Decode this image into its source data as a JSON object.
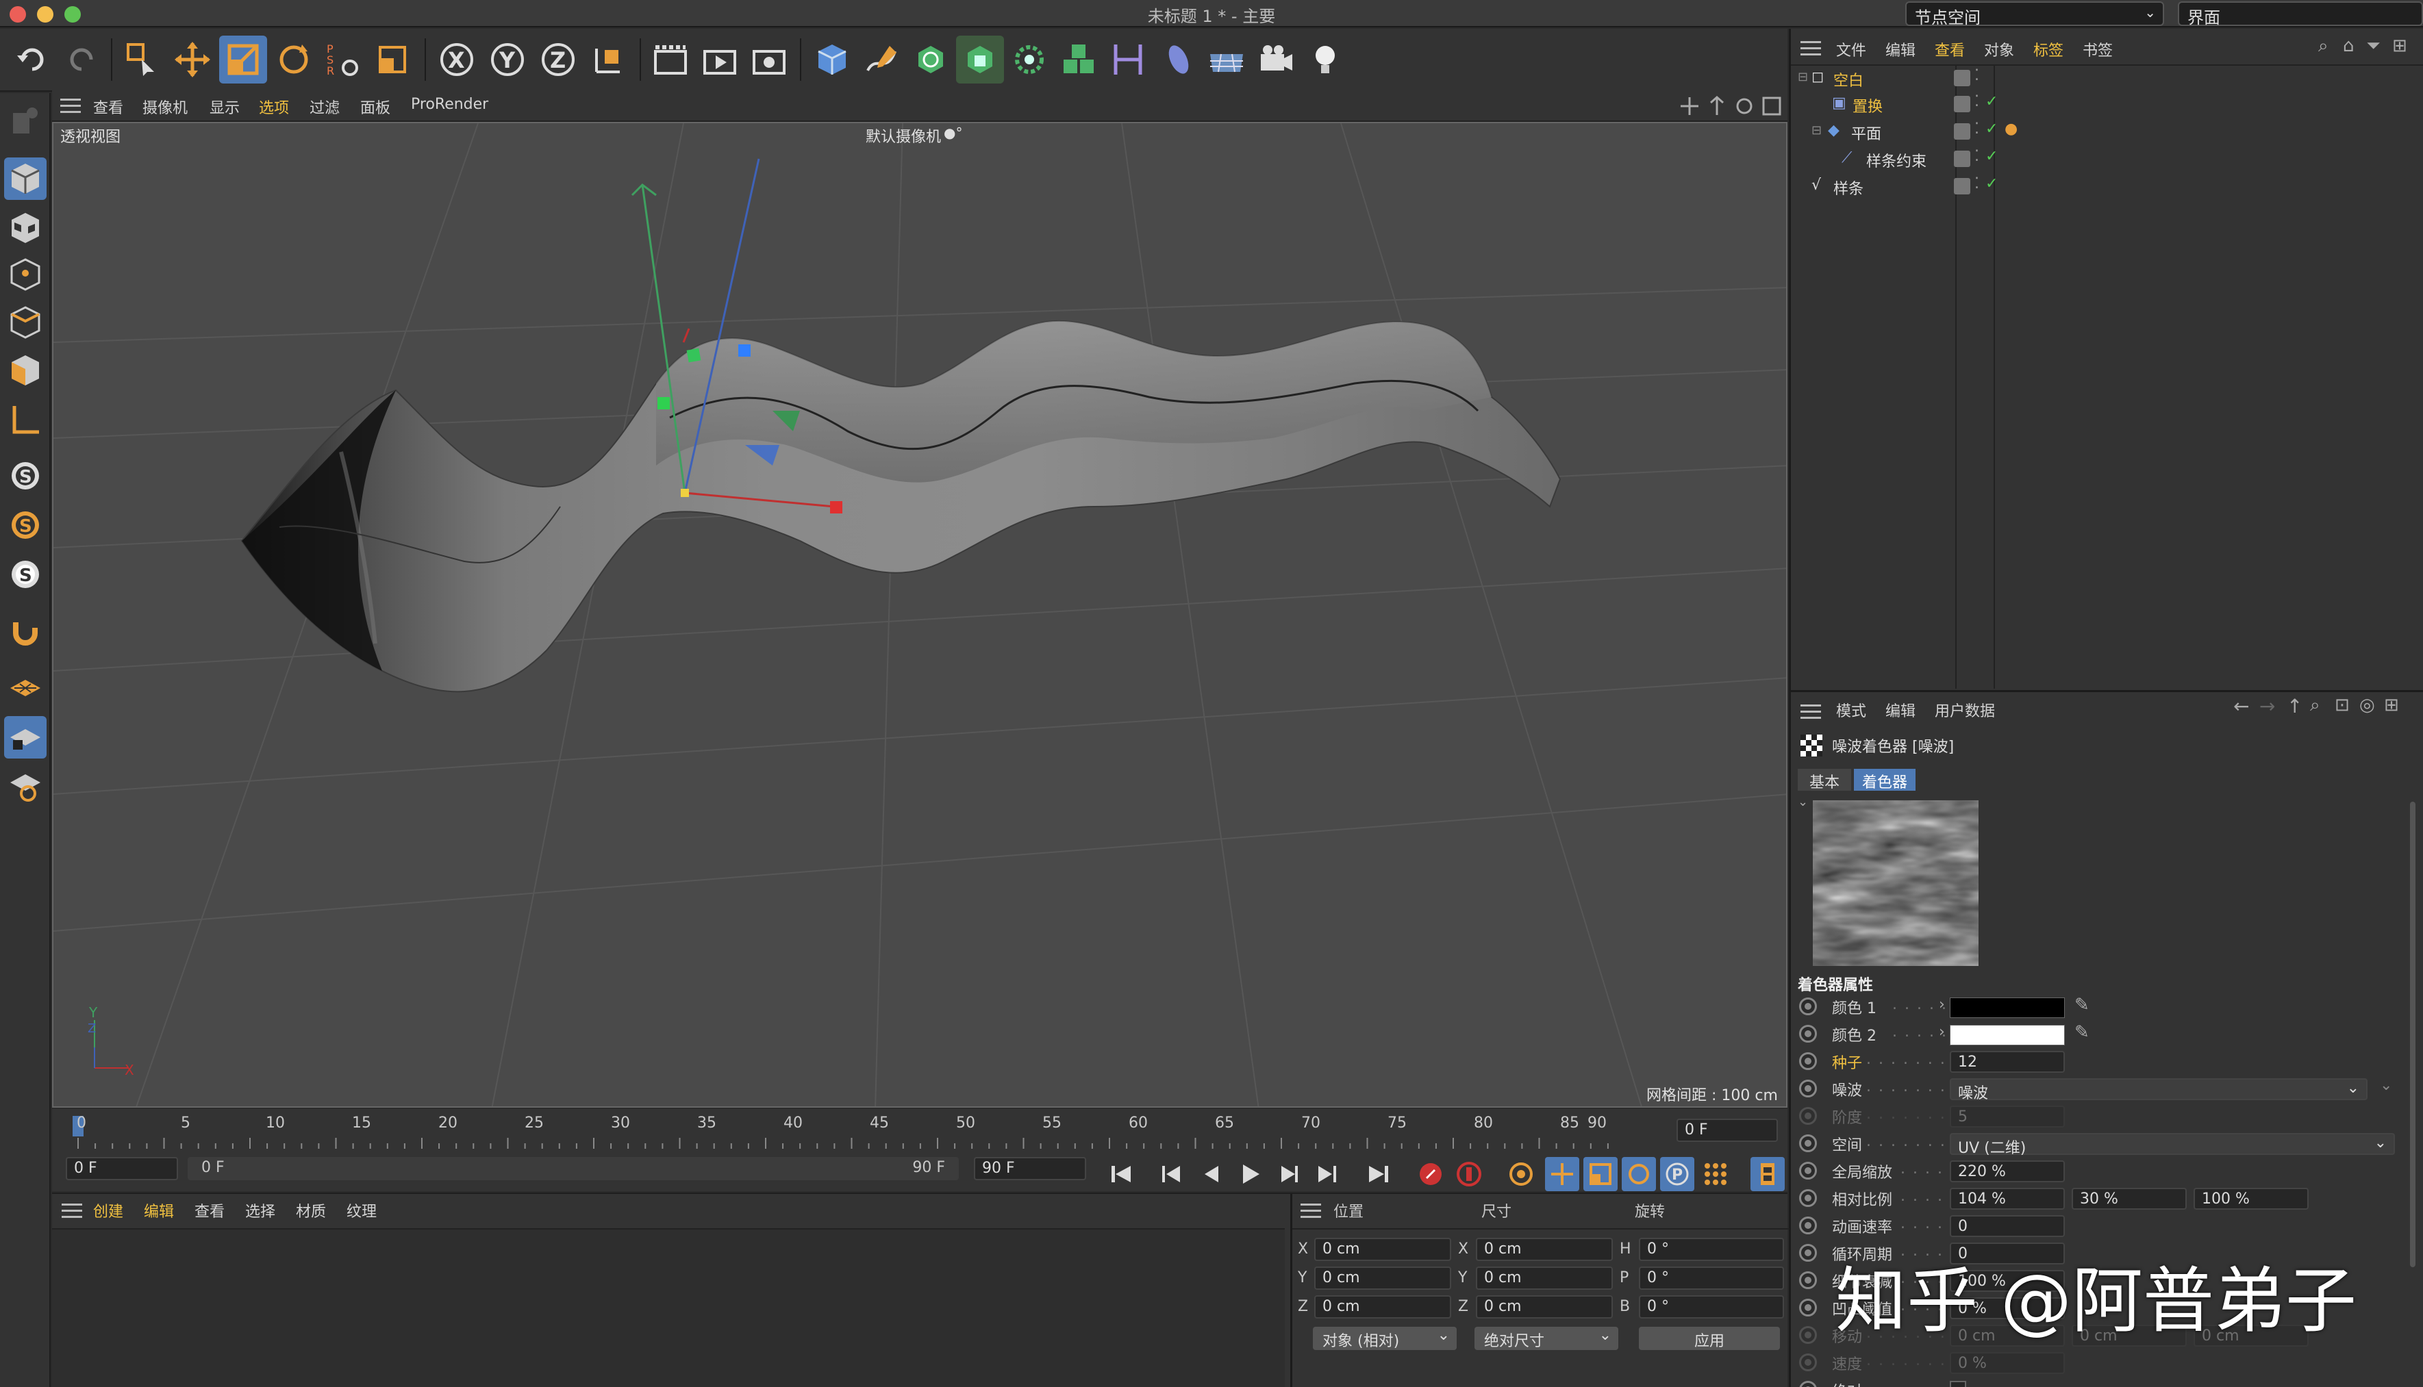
{
  "window": {
    "title": "未标题 1 * - 主要",
    "node_space": "节点空间",
    "layout": "界面"
  },
  "viewport_menu": [
    "查看",
    "摄像机",
    "显示",
    "选项",
    "过滤",
    "面板",
    "ProRender"
  ],
  "viewport": {
    "label": "透视视图",
    "camera": "默认摄像机",
    "grid_info": "网格间距 : 100 cm"
  },
  "objects_menu": [
    "文件",
    "编辑",
    "查看",
    "对象",
    "标签",
    "书签"
  ],
  "objects": [
    {
      "name": "空白",
      "icon": "null-icon"
    },
    {
      "name": "置换",
      "icon": "displacer-icon"
    },
    {
      "name": "平面",
      "icon": "plane-icon"
    },
    {
      "name": "样条约束",
      "icon": "spline-wrap-icon"
    },
    {
      "name": "样条",
      "icon": "spline-icon"
    }
  ],
  "attributes": {
    "menu": [
      "模式",
      "编辑",
      "用户数据"
    ],
    "header": "噪波着色器 [噪波]",
    "tabs": [
      "基本",
      "着色器"
    ],
    "section": "着色器属性",
    "props": [
      {
        "label": "颜色 1",
        "type": "color",
        "value": "#000000"
      },
      {
        "label": "颜色 2",
        "type": "color",
        "value": "#ffffff"
      },
      {
        "label": "种子",
        "type": "num",
        "value": "12"
      },
      {
        "label": "噪波",
        "type": "select",
        "value": "噪波"
      },
      {
        "label": "阶度",
        "type": "num",
        "value": "5"
      },
      {
        "label": "空间",
        "type": "select",
        "value": "UV (二维)"
      },
      {
        "label": "全局缩放",
        "type": "num",
        "value": "220 %"
      },
      {
        "label": "相对比例",
        "type": "vec",
        "values": [
          "104 %",
          "30 %",
          "100 %"
        ]
      },
      {
        "label": "动画速率",
        "type": "num",
        "value": "0"
      },
      {
        "label": "循环周期",
        "type": "num",
        "value": "0"
      },
      {
        "label": "细节衰减",
        "type": "num",
        "value": "100 %"
      },
      {
        "label": "凹凸阈值",
        "type": "num",
        "value": "0 %"
      },
      {
        "label": "移动",
        "type": "vec",
        "values": [
          "0 cm",
          "0 cm",
          "0 cm"
        ]
      },
      {
        "label": "速度",
        "type": "num",
        "value": "0 %"
      },
      {
        "label": "绝对",
        "type": "check",
        "value": ""
      }
    ]
  },
  "timeline": {
    "ticks": [
      "0",
      "5",
      "10",
      "15",
      "20",
      "25",
      "30",
      "35",
      "40",
      "45",
      "50",
      "55",
      "60",
      "65",
      "70",
      "75",
      "80",
      "85",
      "90"
    ],
    "current_frame": "0 F",
    "start_field": "0 F",
    "range_start": "0 F",
    "range_end": "90 F",
    "end_field": "90 F"
  },
  "materials_menu": [
    "创建",
    "编辑",
    "查看",
    "选择",
    "材质",
    "纹理"
  ],
  "coords": {
    "headers": [
      "位置",
      "尺寸",
      "旋转"
    ],
    "rows": [
      {
        "a": "X",
        "pos": "0 cm",
        "b": "X",
        "size": "0 cm",
        "c": "H",
        "rot": "0 °"
      },
      {
        "a": "Y",
        "pos": "0 cm",
        "b": "Y",
        "size": "0 cm",
        "c": "P",
        "rot": "0 °"
      },
      {
        "a": "Z",
        "pos": "0 cm",
        "b": "Z",
        "size": "0 cm",
        "c": "B",
        "rot": "0 °"
      }
    ],
    "mode": "对象 (相对)",
    "size_mode": "绝对尺寸",
    "apply": "应用"
  },
  "watermark": "知乎 @阿普弟子",
  "colors": {
    "accent": "#f0c040",
    "highlight": "#4e7ab5"
  }
}
